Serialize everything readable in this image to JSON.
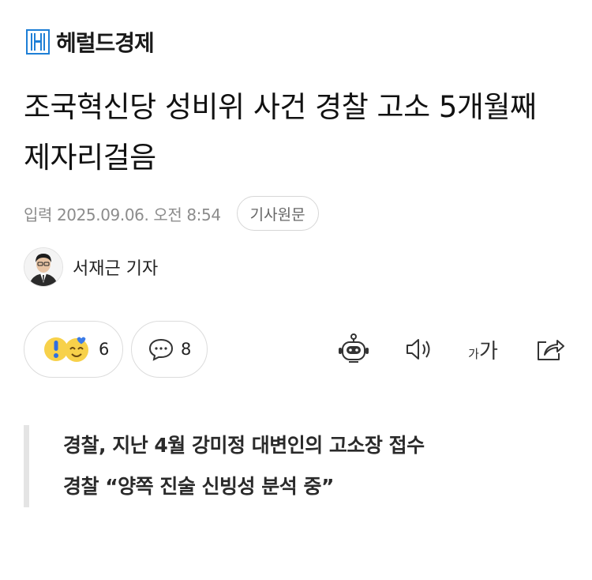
{
  "header": {
    "logo_text": "헤럴드경제"
  },
  "article": {
    "title": "조국혁신당 성비위 사건 경찰 고소 5개월째 제자리걸음",
    "published": "입력 2025.09.06. 오전 8:54",
    "source_button": "기사원문",
    "reporter": "서재근 기자"
  },
  "actions": {
    "reaction_count": "6",
    "comment_count": "8",
    "font_size_small": "가",
    "font_size_large": "가",
    "icons": [
      "robot-summary-icon",
      "speaker-icon",
      "font-size-icon",
      "share-icon"
    ]
  },
  "summary": {
    "lines": [
      "경찰, 지난 4월 강미정 대변인의 고소장 접수",
      "경찰 “양쪽 진술 신빙성 분석 중”"
    ]
  },
  "colors": {
    "logo_blue": "#1e7fd6",
    "meta_gray": "#8c8c8c",
    "border": "#dcdcdc",
    "quote_bar": "#e4e4e4"
  }
}
